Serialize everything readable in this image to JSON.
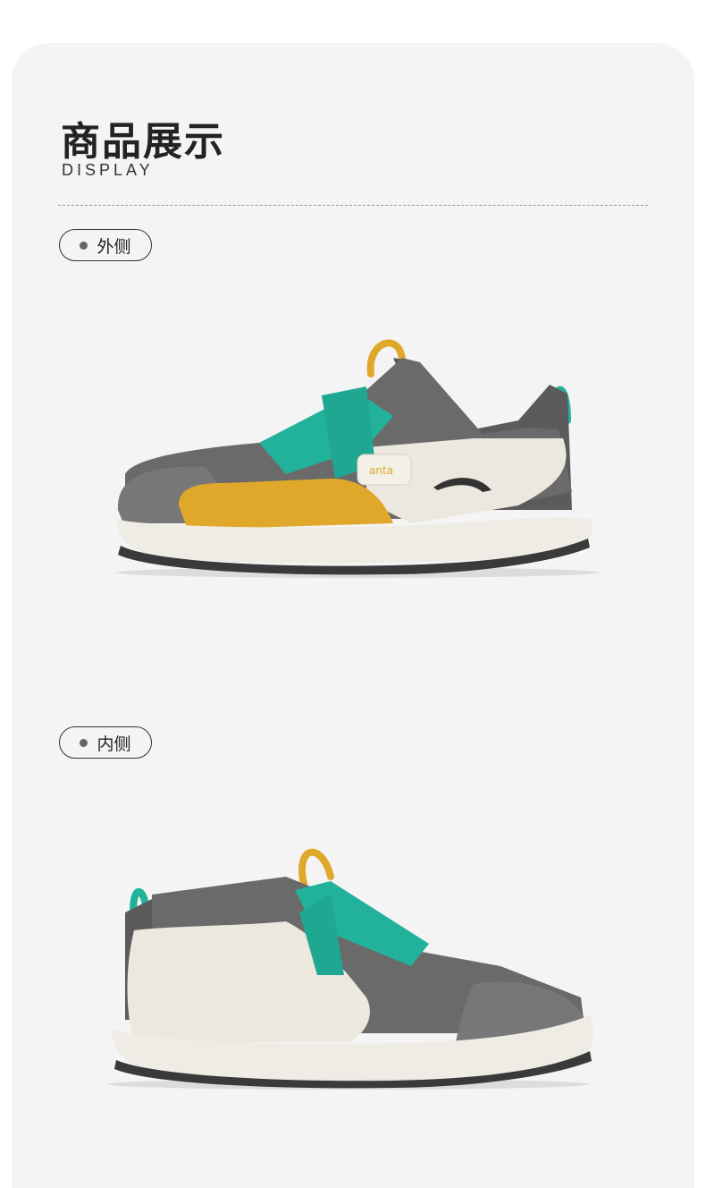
{
  "header": {
    "title": "商品展示",
    "subtitle": "DISPLAY"
  },
  "views": [
    {
      "label": "外侧",
      "image": "shoe-outer-side"
    },
    {
      "label": "内侧",
      "image": "shoe-inner-side"
    }
  ],
  "colors": {
    "background": "#f4f4f4",
    "mesh_gray": "#5b5b5b",
    "teal_strap": "#22b29c",
    "mustard": "#e0a82a",
    "cream": "#ece8df"
  }
}
